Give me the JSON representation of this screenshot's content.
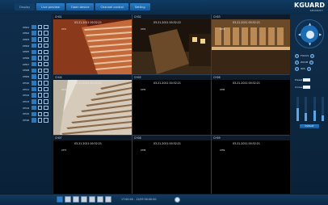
{
  "topbar": {
    "tabs": [
      {
        "label": "Display",
        "active": false
      },
      {
        "label": "Live preview",
        "active": true
      },
      {
        "label": "Open device",
        "active": true
      },
      {
        "label": "Channel control",
        "active": true
      },
      {
        "label": "Setting",
        "active": true
      }
    ]
  },
  "logo": {
    "brand": "KGUARD",
    "sub": "SECURITY"
  },
  "left_panel": {
    "channels": [
      "CH01",
      "CH02",
      "CH03",
      "CH04",
      "CH05",
      "CH06",
      "CH07",
      "CH08",
      "CH09",
      "CH10",
      "CH11",
      "CH12",
      "CH13",
      "CH14",
      "CH15",
      "CH16"
    ]
  },
  "video": {
    "cells": [
      {
        "header": "CH01",
        "timestamp": "03-21-2011 00:32:21",
        "name": "CH1",
        "has_image": true,
        "scene": "stairs-warm"
      },
      {
        "header": "CH02",
        "timestamp": "03-21-2011 00:32:22",
        "name": "CH2",
        "has_image": true,
        "scene": "street-night"
      },
      {
        "header": "CH03",
        "timestamp": "03-21-2011 00:32:21",
        "name": "CH3",
        "has_image": true,
        "scene": "interior-bar"
      },
      {
        "header": "CH04",
        "timestamp": "03-21-2011 00:32:21",
        "name": "CH4",
        "has_image": true,
        "scene": "stairs-white"
      },
      {
        "header": "CH05",
        "timestamp": "03-21-2011 00:32:21",
        "name": "CH5",
        "has_image": false
      },
      {
        "header": "CH06",
        "timestamp": "03-21-2011 00:32:21",
        "name": "CH6",
        "has_image": false
      },
      {
        "header": "CH07",
        "timestamp": "03-21-2011 00:32:21",
        "name": "CH7",
        "has_image": false
      },
      {
        "header": "CH08",
        "timestamp": "03-21-2011 00:32:21",
        "name": "CH8",
        "has_image": false
      },
      {
        "header": "CH09",
        "timestamp": "03-21-2011 00:32:21",
        "name": "CH9",
        "has_image": false
      }
    ]
  },
  "right_panel": {
    "ptz": {
      "up": "▲",
      "down": "▼",
      "left": "◀",
      "right": "▶"
    },
    "controls": [
      {
        "label": "FOCUS"
      },
      {
        "label": "ZOOM"
      },
      {
        "label": "IRIS"
      }
    ],
    "fields": [
      {
        "label": "Preset"
      },
      {
        "label": "Cruise"
      }
    ],
    "sliders": [
      0.55,
      0.35,
      0.45,
      0.25
    ],
    "default_label": "Default"
  },
  "bottombar": {
    "time_text": "17:00:00  -  12/09  00:00:00"
  },
  "colors": {
    "accent": "#2b7cc6",
    "background": "#0d2740"
  }
}
